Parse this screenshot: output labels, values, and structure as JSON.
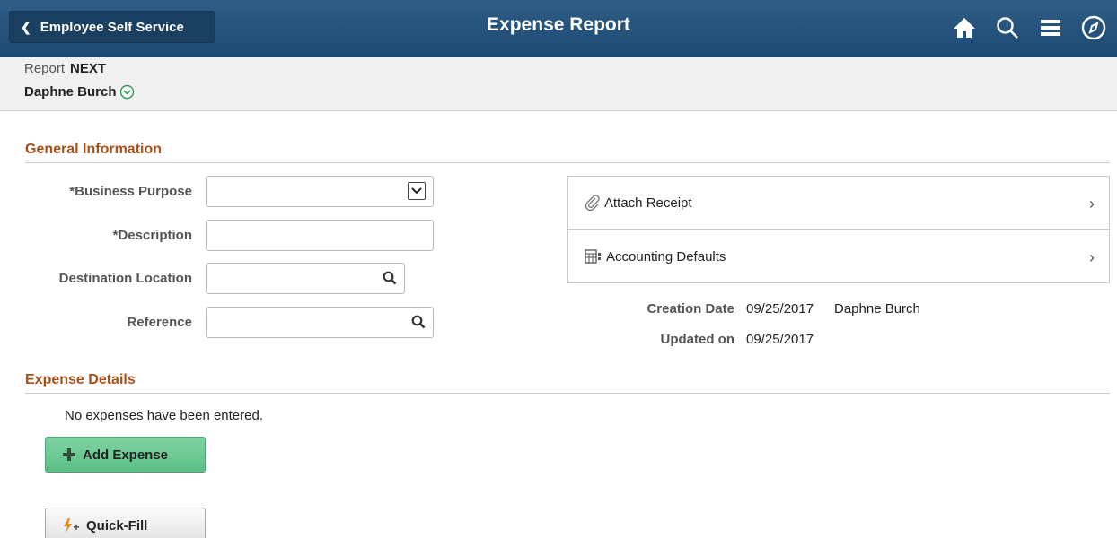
{
  "banner": {
    "back_label": "Employee Self Service",
    "title": "Expense Report",
    "icons": [
      "home-icon",
      "search-icon",
      "menu-icon",
      "navbar-compass-icon"
    ]
  },
  "header": {
    "report_label": "Report",
    "report_value": "NEXT",
    "person_name": "Daphne Burch"
  },
  "general_info": {
    "title": "General Information",
    "fields": {
      "business_purpose": {
        "label": "*Business Purpose",
        "value": ""
      },
      "description": {
        "label": "*Description",
        "value": ""
      },
      "destination_location": {
        "label": "Destination Location",
        "value": ""
      },
      "reference": {
        "label": "Reference",
        "value": ""
      }
    },
    "links": {
      "attach_receipt": "Attach Receipt",
      "accounting_defaults": "Accounting Defaults"
    },
    "meta": {
      "creation_label": "Creation Date",
      "creation_date": "09/25/2017",
      "creation_user": "Daphne Burch",
      "updated_label": "Updated on",
      "updated_date": "09/25/2017"
    }
  },
  "expense_details": {
    "title": "Expense Details",
    "empty_message": "No expenses have been entered.",
    "add_button": "Add Expense",
    "quickfill_button": "Quick-Fill"
  },
  "colors": {
    "banner": "#1c4a73",
    "section_title": "#a9501a",
    "add_button": "#5cbf86"
  }
}
